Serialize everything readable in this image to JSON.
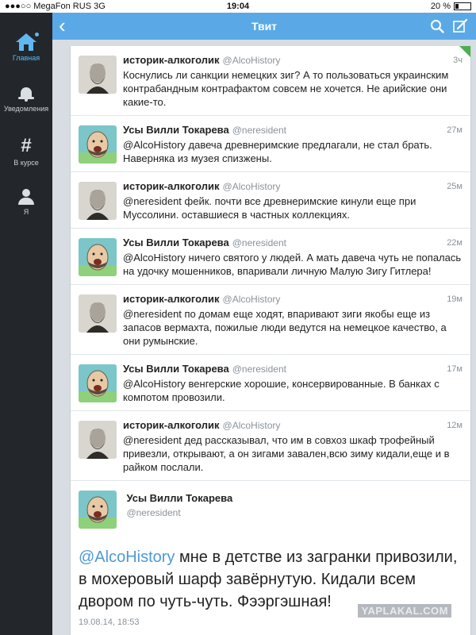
{
  "status_bar": {
    "carrier": "●●●○○ MegaFon RUS   3G",
    "time": "19:04",
    "battery_text": "20 %"
  },
  "sidebar": {
    "items": [
      {
        "label": "Главная",
        "icon": "home-icon",
        "active": true
      },
      {
        "label": "Уведомления",
        "icon": "bell-icon",
        "active": false
      },
      {
        "label": "В курсе",
        "icon": "hashtag-icon",
        "active": false
      },
      {
        "label": "Я",
        "icon": "person-icon",
        "active": false
      }
    ]
  },
  "header": {
    "title": "Твит",
    "back_icon": "‹",
    "accent": "#5aa9e6"
  },
  "tweets": [
    {
      "name": "историк-алкоголик",
      "handle": "@AlcoHistory",
      "time": "3ч",
      "avatar": "historian",
      "text": "Коснулись ли санкции немецких зиг? А то пользоваться украинским контрабандным контрафактом совсем не хочется. Не арийские они какие-то."
    },
    {
      "name": "Усы Вилли Токарева",
      "handle": "@neresident",
      "time": "27м",
      "avatar": "cartoon",
      "text": "@AlcoHistory давеча древнеримские предлагали, не стал брать. Наверняка из музея спизжены."
    },
    {
      "name": "историк-алкоголик",
      "handle": "@AlcoHistory",
      "time": "25м",
      "avatar": "historian",
      "text": "@neresident фейк. почти все древнеримские кинули еще при Муссолини. оставшиеся в частных коллекциях."
    },
    {
      "name": "Усы Вилли Токарева",
      "handle": "@neresident",
      "time": "22м",
      "avatar": "cartoon",
      "text": "@AlcoHistory ничего святого у людей. А мать давеча чуть не попалась на удочку мошенников, впаривали личную Малую Зигу Гитлера!"
    },
    {
      "name": "историк-алкоголик",
      "handle": "@AlcoHistory",
      "time": "19м",
      "avatar": "historian",
      "text": "@neresident по домам еще ходят, впаривают зиги якобы еще из запасов вермахта, пожилые люди ведутся на немецкое качество, а они румынские."
    },
    {
      "name": "Усы Вилли Токарева",
      "handle": "@neresident",
      "time": "17м",
      "avatar": "cartoon",
      "text": "@AlcoHistory венгерские хорошие, консервированные. В банках с компотом провозили."
    },
    {
      "name": "историк-алкоголик",
      "handle": "@AlcoHistory",
      "time": "12м",
      "avatar": "historian",
      "text": "@neresident дед рассказывал, что им в совхоз шкаф трофейный привезли, открывают, а он зигами завален,всю зиму кидали,еще и в райком послали."
    }
  ],
  "focus_tweet": {
    "name": "Усы Вилли Токарева",
    "handle": "@neresident",
    "mention": "@AlcoHistory",
    "text": " мне в детстве из загранки привозили, в мохеровый шарф завёрнутую. Кидали всем двором по чуть-чуть. Фээргэшная!",
    "date": "19.08.14, 18:53",
    "mention_color": "#4f9ad6"
  },
  "watermark": "YAPLAKAL.COM"
}
